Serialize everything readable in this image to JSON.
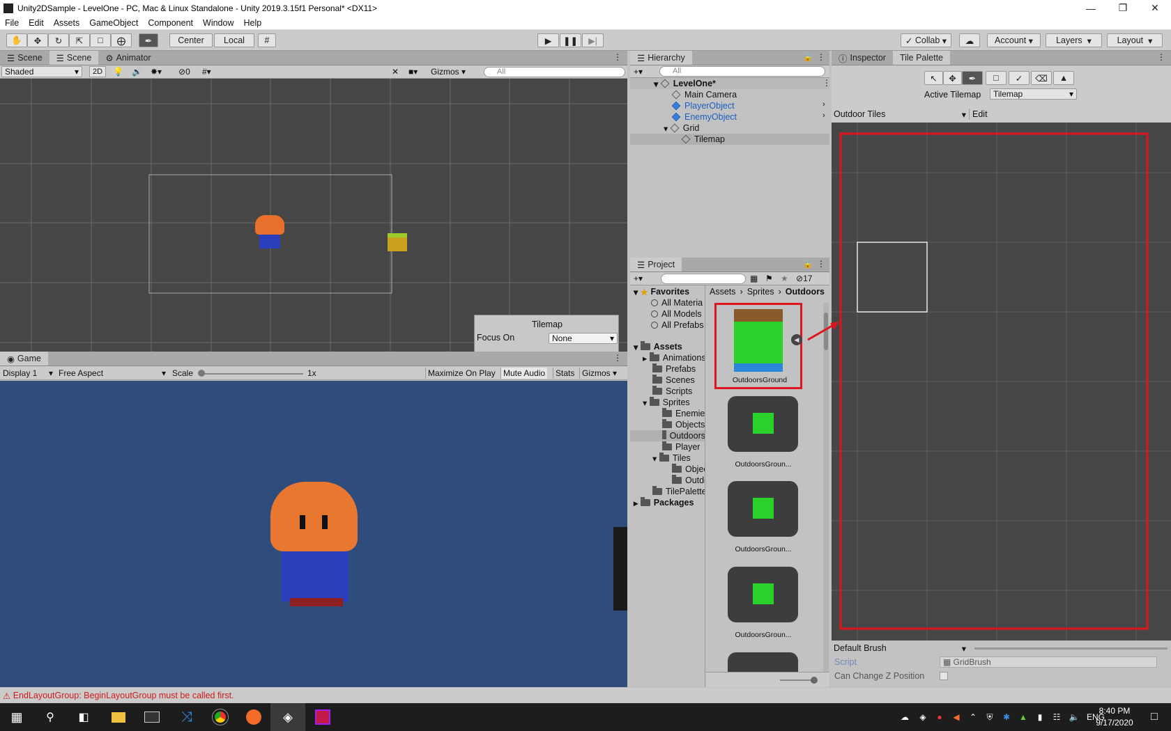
{
  "window": {
    "title": "Unity2DSample - LevelOne - PC, Mac & Linux Standalone - Unity 2019.3.15f1 Personal* <DX11>"
  },
  "menu": [
    "File",
    "Edit",
    "Assets",
    "GameObject",
    "Component",
    "Window",
    "Help"
  ],
  "toolbar": {
    "center": "Center",
    "local": "Local",
    "collab": "Collab",
    "account": "Account",
    "layers": "Layers",
    "layout": "Layout"
  },
  "scene": {
    "tabs": [
      "Scene",
      "Scene",
      "Animator"
    ],
    "shading": "Shaded",
    "mode2d": "2D",
    "hidden_count": "0",
    "gizmos": "Gizmos",
    "search_placeholder": "All",
    "overlay": {
      "title": "Tilemap",
      "focus_label": "Focus On",
      "focus_value": "None"
    }
  },
  "game": {
    "tab": "Game",
    "display": "Display 1",
    "aspect": "Free Aspect",
    "scale_label": "Scale",
    "scale_value": "1x",
    "maximize": "Maximize On Play",
    "mute": "Mute Audio",
    "stats": "Stats",
    "gizmos": "Gizmos"
  },
  "hierarchy": {
    "tab": "Hierarchy",
    "search_placeholder": "All",
    "items": [
      {
        "label": "LevelOne*"
      },
      {
        "label": "Main Camera"
      },
      {
        "label": "PlayerObject"
      },
      {
        "label": "EnemyObject"
      },
      {
        "label": "Grid"
      },
      {
        "label": "Tilemap"
      }
    ]
  },
  "project": {
    "tab": "Project",
    "hidden_count": "17",
    "favorites": {
      "label": "Favorites",
      "items": [
        "All Materia",
        "All Models",
        "All Prefabs"
      ]
    },
    "assets": {
      "label": "Assets",
      "items": [
        "Animations",
        "Prefabs",
        "Scenes",
        "Scripts",
        "Sprites",
        "Enemies",
        "Objects",
        "Outdoors",
        "Player",
        "Tiles",
        "Objec",
        "Outdo",
        "TilePalette"
      ]
    },
    "packages": "Packages",
    "breadcrumb": [
      "Assets",
      "Sprites",
      "Outdoors"
    ],
    "thumbs": [
      "OutdoorsGround",
      "OutdoorsGroun...",
      "OutdoorsGroun...",
      "OutdoorsGroun..."
    ]
  },
  "inspector": {
    "tabs": [
      "Inspector",
      "Tile Palette"
    ],
    "active_tilemap_label": "Active Tilemap",
    "active_tilemap_value": "Tilemap",
    "palette": "Outdoor Tiles",
    "edit": "Edit",
    "brush": "Default Brush",
    "script_label": "Script",
    "script_value": "GridBrush",
    "z_label": "Can Change Z Position"
  },
  "status": {
    "message": "EndLayoutGroup: BeginLayoutGroup must be called first."
  },
  "taskbar": {
    "lang": "ENG",
    "time": "8:40 PM",
    "date": "9/17/2020"
  },
  "colors": {
    "accent_red": "#e0141e",
    "scene_bg": "#464646",
    "game_bg": "#2f4d7c",
    "link_blue": "#1d5ec4"
  }
}
